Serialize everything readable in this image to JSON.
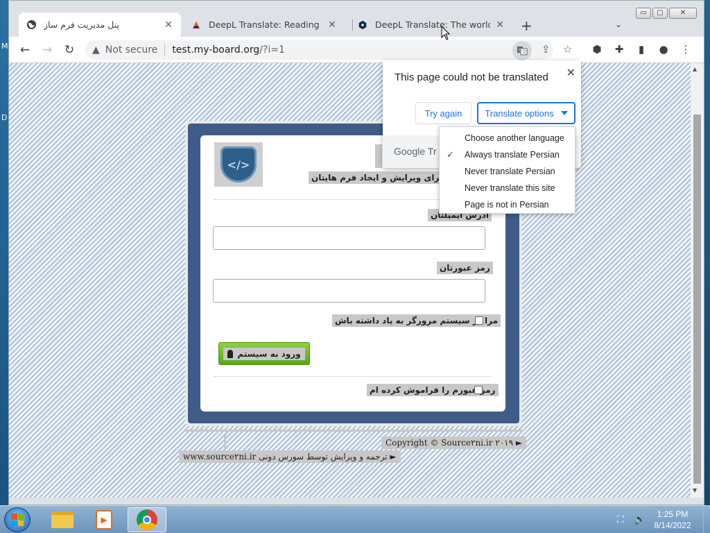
{
  "desktop": {
    "left_glyph_1": "M",
    "left_glyph_2": "D"
  },
  "browser": {
    "tabs": [
      {
        "title": "پنل مدیریت فرم ساز",
        "favicon": "globe-icon"
      },
      {
        "title": "DeepL Translate: Reading & writing",
        "favicon": "deepl-pen-icon"
      },
      {
        "title": "DeepL Translate: The world's most",
        "favicon": "deepl-icon"
      }
    ],
    "new_tab": "+",
    "window_controls": {
      "minimize": "▭",
      "maximize": "▢",
      "close": "✕"
    },
    "security_label": "Not secure",
    "url_host": "test.my-board.org",
    "url_rest": "/?i=1"
  },
  "translate": {
    "message": "This page could not be translated",
    "try_again": "Try again",
    "options": "Translate options",
    "footer": "Google Tr",
    "menu": [
      {
        "label": "Choose another language",
        "checked": false
      },
      {
        "label": "Always translate Persian",
        "checked": true
      },
      {
        "label": "Never translate Persian",
        "checked": false
      },
      {
        "label": "Never translate this site",
        "checked": false
      },
      {
        "label": "Page is not in Persian",
        "checked": false
      }
    ]
  },
  "page": {
    "subtitle": "ن . برای ویرایش و ایجاد فرم هایتان",
    "email_label": "آدرس ایمیلتان",
    "password_label": "رمز عبورتان",
    "remember_label": "مرا در سیستم مرورگر به یاد داشته باش",
    "login_button": "ورود به سیستم",
    "forgot_label": "رمز عبورم را فراموش کرده ام",
    "copyright": "Copyright © Source۲ni.ir ۲۰۱۹ ►",
    "credit": "www.source۲ni.ir ترجمه و ویرایش توسط سورس دونی ►",
    "logo_glyph": "</>"
  },
  "taskbar": {
    "time": "1:25 PM",
    "date": "8/14/2022"
  }
}
